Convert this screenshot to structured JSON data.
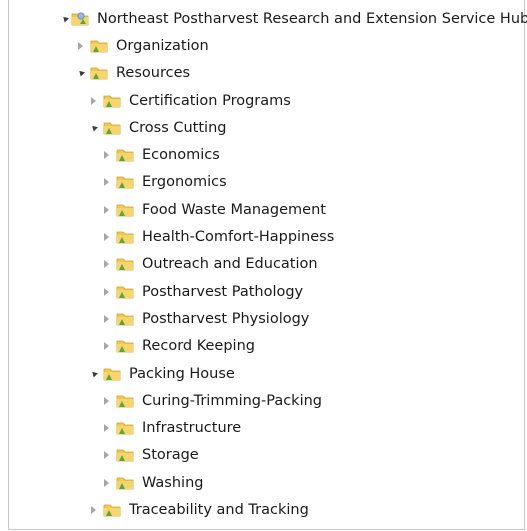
{
  "tree": {
    "root": {
      "label": "Northeast Postharvest Research and Extension Service Hub",
      "state": "expanded"
    },
    "organization": {
      "label": "Organization",
      "state": "collapsed"
    },
    "resources": {
      "label": "Resources",
      "state": "expanded"
    },
    "certification_programs": {
      "label": "Certification Programs",
      "state": "collapsed"
    },
    "cross_cutting": {
      "label": "Cross Cutting",
      "state": "expanded"
    },
    "economics": {
      "label": "Economics",
      "state": "collapsed"
    },
    "ergonomics": {
      "label": "Ergonomics",
      "state": "collapsed"
    },
    "food_waste_management": {
      "label": "Food Waste Management",
      "state": "collapsed"
    },
    "health_comfort_happiness": {
      "label": "Health-Comfort-Happiness",
      "state": "collapsed"
    },
    "outreach_and_education": {
      "label": "Outreach and Education",
      "state": "collapsed"
    },
    "postharvest_pathology": {
      "label": "Postharvest Pathology",
      "state": "collapsed"
    },
    "postharvest_physiology": {
      "label": "Postharvest Physiology",
      "state": "collapsed"
    },
    "record_keeping": {
      "label": "Record Keeping",
      "state": "collapsed"
    },
    "packing_house": {
      "label": "Packing House",
      "state": "expanded"
    },
    "curing_trimming_packing": {
      "label": "Curing-Trimming-Packing",
      "state": "collapsed"
    },
    "infrastructure": {
      "label": "Infrastructure",
      "state": "collapsed"
    },
    "storage": {
      "label": "Storage",
      "state": "collapsed"
    },
    "washing": {
      "label": "Washing",
      "state": "collapsed"
    },
    "traceability_and_tracking": {
      "label": "Traceability and Tracking",
      "state": "collapsed"
    }
  },
  "icons": {
    "root": "site-folder-icon",
    "folder": "folder-icon",
    "expand_arrow": "chevron-right-icon",
    "collapse_arrow": "chevron-down-icon"
  },
  "colors": {
    "folder_yellow": "#f2c94c",
    "folder_green": "#5aa63a",
    "arrow_collapsed": "#a6a6a6",
    "arrow_expanded": "#3c3c3c",
    "border": "#c8c8c8"
  }
}
